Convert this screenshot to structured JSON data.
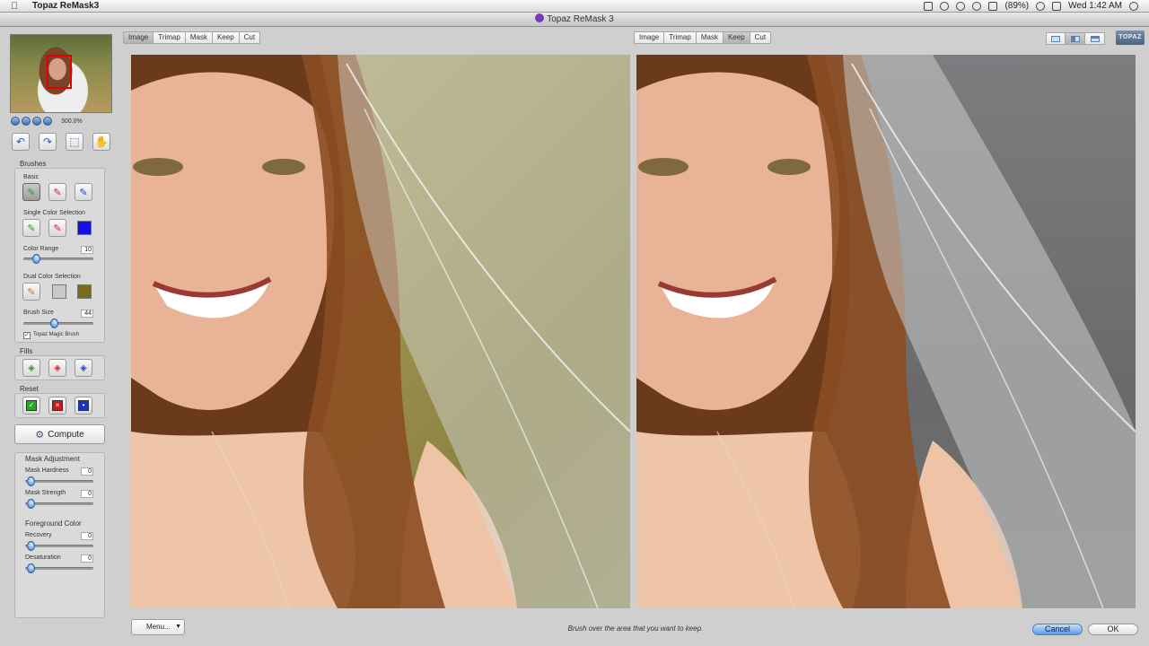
{
  "menubar": {
    "apple_icon": "apple-icon",
    "app_name": "Topaz ReMask3",
    "battery": "(89%)",
    "clock": "Wed 1:42 AM"
  },
  "window": {
    "title": "Topaz ReMask 3"
  },
  "navigator": {
    "zoom": "300.0%"
  },
  "brushes": {
    "title": "Brushes",
    "basic_label": "Basic",
    "single_label": "Single Color Selection",
    "color_range_label": "Color Range",
    "color_range_value": "10",
    "color_range_level": 0.14,
    "single_swatch": "#1010e6",
    "dual_label": "Dual Color Selection",
    "dual_swatch_1": "#c9c9c9",
    "dual_swatch_2": "#786a1f",
    "brush_size_label": "Brush Size",
    "brush_size_value": "44",
    "brush_size_level": 0.44,
    "magic_brush_label": "Topaz Magic Brush",
    "magic_brush_checked": true
  },
  "fills": {
    "title": "Fills"
  },
  "reset": {
    "title": "Reset"
  },
  "compute": {
    "label": "Compute"
  },
  "mask_adjustment": {
    "title": "Mask Adjustment",
    "hardness_label": "Mask Hardness",
    "hardness_value": "0",
    "strength_label": "Mask Strength",
    "strength_value": "0"
  },
  "foreground_color": {
    "title": "Foreground Color",
    "recovery_label": "Recovery",
    "recovery_value": "0",
    "desaturation_label": "Desaturation",
    "desaturation_value": "0"
  },
  "left_tabs": [
    "Image",
    "Trimap",
    "Mask",
    "Keep",
    "Cut"
  ],
  "left_active_tab": "Image",
  "right_tabs": [
    "Image",
    "Trimap",
    "Mask",
    "Keep",
    "Cut"
  ],
  "right_active_tab": "Keep",
  "brand": "TOPAZ",
  "bottom": {
    "menu_label": "Menu...",
    "status": "Brush over the area that you want to keep.",
    "cancel_label": "Cancel",
    "ok_label": "OK"
  }
}
